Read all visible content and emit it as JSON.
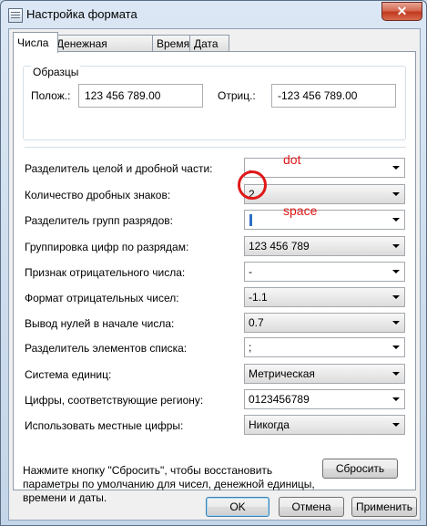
{
  "window": {
    "title": "Настройка формата",
    "close_glyph": "✕"
  },
  "tabs": [
    "Числа",
    "Денежная единица",
    "Время",
    "Дата"
  ],
  "samples": {
    "title": "Образцы",
    "positive_label": "Полож.:",
    "positive_value": "123 456 789.00",
    "negative_label": "Отриц.:",
    "negative_value": "-123 456 789.00"
  },
  "settings": [
    {
      "label": "Разделитель целой и дробной части:",
      "value": "."
    },
    {
      "label": "Количество дробных знаков:",
      "value": "2"
    },
    {
      "label": "Разделитель групп разрядов:",
      "value": " "
    },
    {
      "label": "Группировка цифр по разрядам:",
      "value": "123 456 789"
    },
    {
      "label": "Признак отрицательного числа:",
      "value": "-"
    },
    {
      "label": "Формат отрицательных чисел:",
      "value": "-1.1"
    },
    {
      "label": "Вывод нулей в начале числа:",
      "value": "0.7"
    },
    {
      "label": "Разделитель элементов списка:",
      "value": ";"
    },
    {
      "label": "Система единиц:",
      "value": "Метрическая"
    },
    {
      "label": "Цифры, соответствующие региону:",
      "value": "0123456789"
    },
    {
      "label": "Использовать местные цифры:",
      "value": "Никогда"
    }
  ],
  "note": "Нажмите кнопку \"Сбросить\", чтобы восстановить параметры по умолчанию для чисел, денежной единицы, времени и даты.",
  "buttons": {
    "reset": "Сбросить",
    "ok": "OK",
    "cancel": "Отмена",
    "apply": "Применить"
  },
  "annotations": {
    "dot": "dot",
    "space": "space",
    "color": "#e01818"
  }
}
